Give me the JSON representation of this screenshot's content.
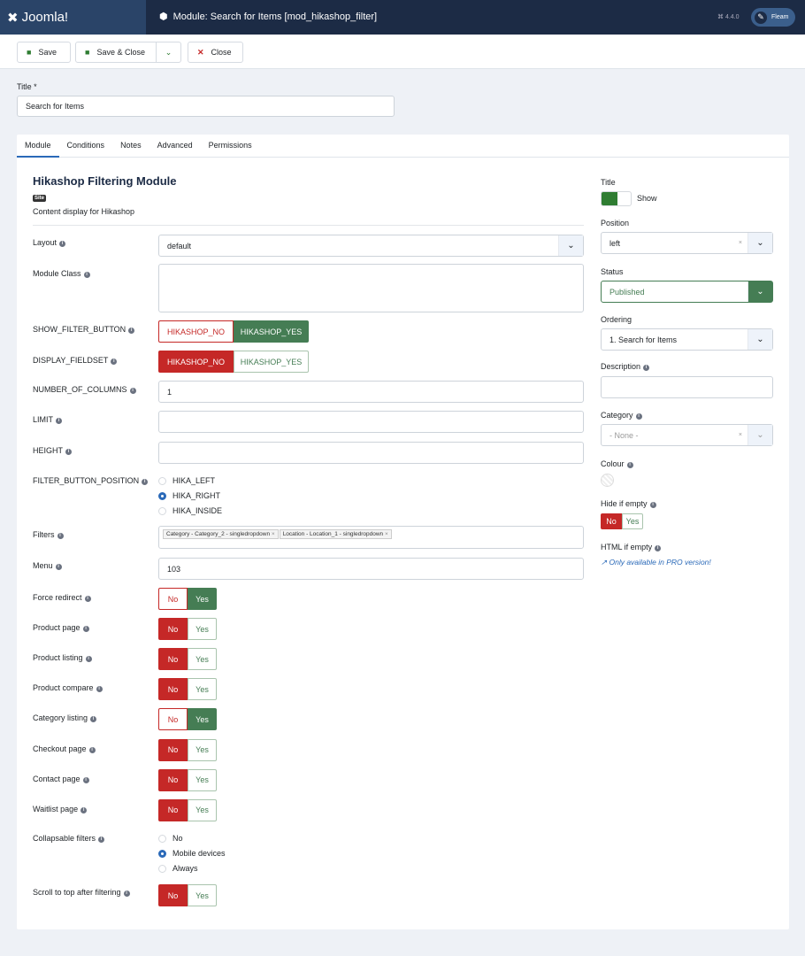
{
  "header": {
    "logo": "Joomla!",
    "title": "Module: Search for Items [mod_hikashop_filter]",
    "version": "4.4.0",
    "user": "Fleam"
  },
  "toolbar": {
    "save": "Save",
    "save_close": "Save & Close",
    "close": "Close"
  },
  "title_field": {
    "label": "Title *",
    "value": "Search for Items"
  },
  "tabs": [
    "Module",
    "Conditions",
    "Notes",
    "Advanced",
    "Permissions"
  ],
  "module": {
    "name": "Hikashop Filtering Module",
    "badge": "Site",
    "description": "Content display for Hikashop"
  },
  "fields": {
    "layout": {
      "label": "Layout",
      "value": "default"
    },
    "module_class": {
      "label": "Module Class",
      "value": ""
    },
    "show_filter_button": {
      "label": "SHOW_FILTER_BUTTON",
      "no": "HIKASHOP_NO",
      "yes": "HIKASHOP_YES",
      "selected": "yes"
    },
    "display_fieldset": {
      "label": "DISPLAY_FIELDSET",
      "no": "HIKASHOP_NO",
      "yes": "HIKASHOP_YES",
      "selected": "no"
    },
    "number_of_columns": {
      "label": "NUMBER_OF_COLUMNS",
      "value": "1"
    },
    "limit": {
      "label": "LIMIT",
      "value": ""
    },
    "height": {
      "label": "HEIGHT",
      "value": ""
    },
    "filter_button_position": {
      "label": "FILTER_BUTTON_POSITION",
      "options": [
        "HIKA_LEFT",
        "HIKA_RIGHT",
        "HIKA_INSIDE"
      ],
      "selected": "HIKA_RIGHT"
    },
    "filters": {
      "label": "Filters",
      "chips": [
        "Category - Category_2 - singledropdown",
        "Location - Location_1 - singledropdown"
      ]
    },
    "menu": {
      "label": "Menu",
      "value": "103"
    },
    "toggles": [
      {
        "label": "Force redirect",
        "selected": "yes"
      },
      {
        "label": "Product page",
        "selected": "no"
      },
      {
        "label": "Product listing",
        "selected": "no"
      },
      {
        "label": "Product compare",
        "selected": "no"
      },
      {
        "label": "Category listing",
        "selected": "yes"
      },
      {
        "label": "Checkout page",
        "selected": "no"
      },
      {
        "label": "Contact page",
        "selected": "no"
      },
      {
        "label": "Waitlist page",
        "selected": "no"
      }
    ],
    "toggle_no": "No",
    "toggle_yes": "Yes",
    "collapsable": {
      "label": "Collapsable filters",
      "options": [
        "No",
        "Mobile devices",
        "Always"
      ],
      "selected": "Mobile devices"
    },
    "scroll_top": {
      "label": "Scroll to top after filtering",
      "selected": "no"
    }
  },
  "sidebar": {
    "title": {
      "label": "Title",
      "toggle_label": "Show",
      "on": true
    },
    "position": {
      "label": "Position",
      "value": "left"
    },
    "status": {
      "label": "Status",
      "value": "Published"
    },
    "ordering": {
      "label": "Ordering",
      "value": "1. Search for Items"
    },
    "description": {
      "label": "Description",
      "value": ""
    },
    "category": {
      "label": "Category",
      "value": "- None -"
    },
    "colour": {
      "label": "Colour"
    },
    "hide_if_empty": {
      "label": "Hide if empty",
      "selected": "no"
    },
    "html_if_empty": {
      "label": "HTML if empty",
      "link": "Only available in PRO version!"
    }
  },
  "colors": {
    "green": "#457d54",
    "red": "#c52827",
    "header": "#1c2b45"
  }
}
